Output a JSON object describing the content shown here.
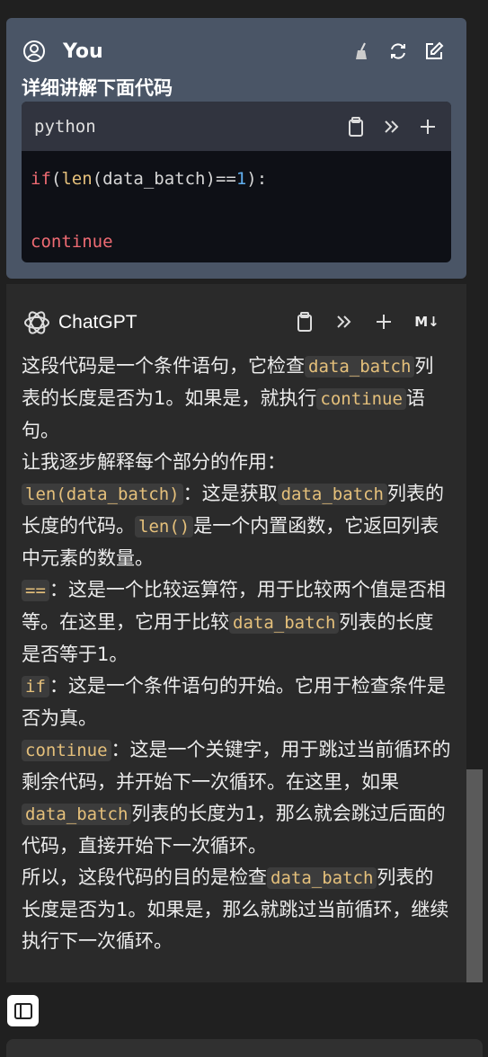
{
  "user_message": {
    "author": "You",
    "text": "详细讲解下面代码",
    "code": {
      "language": "python",
      "line1": {
        "kw": "if",
        "p1": "(",
        "fn": "len",
        "p2": "(data_batch)==",
        "num": "1",
        "p3": "):"
      },
      "line3": "continue"
    }
  },
  "gpt_message": {
    "author": "ChatGPT",
    "markdown_badge": "M↓",
    "p1": {
      "t1": "这段代码是一个条件语句，它检查",
      "c1": "data_batch",
      "t2": "列表的长度是否为1。如果是，就执行",
      "c2": "continue",
      "t3": "语句。"
    },
    "p2": "让我逐步解释每个部分的作用：",
    "p3": {
      "c1": "len(data_batch)",
      "t1": "：这是获取",
      "c2": "data_batch",
      "t2": "列表的长度的代码。",
      "c3": "len()",
      "t3": "是一个内置函数，它返回列表中元素的数量。"
    },
    "p4": {
      "c1": "==",
      "t1": "：这是一个比较运算符，用于比较两个值是否相等。在这里，它用于比较",
      "c2": "data_batch",
      "t2": "列表的长度是否等于1。"
    },
    "p5": {
      "c1": "if",
      "t1": "：这是一个条件语句的开始。它用于检查条件是否为真。"
    },
    "p6": {
      "c1": "continue",
      "t1": "：这是一个关键字，用于跳过当前循环的剩余代码，并开始下一次循环。在这里，如果",
      "c2": "data_batch",
      "t2": "列表的长度为1，那么就会跳过后面的代码，直接开始下一次循环。"
    },
    "p7": {
      "t1": "所以，这段代码的目的是检查",
      "c1": "data_batch",
      "t2": "列表的长度是否为1。如果是，那么就跳过当前循环，继续执行下一次循环。"
    }
  },
  "colors": {
    "user_bg": "#4a5566",
    "gpt_bg": "#2a2a2a",
    "code_bg": "#0e1016",
    "keyword": "#ef6b73",
    "function": "#e5c07b",
    "number": "#61afef"
  },
  "icons": [
    "user-avatar-icon",
    "broom-icon",
    "refresh-icon",
    "edit-icon",
    "clipboard-icon",
    "chevrons-right-icon",
    "plus-icon",
    "openai-logo-icon",
    "markdown-icon",
    "sidebar-toggle-icon"
  ]
}
